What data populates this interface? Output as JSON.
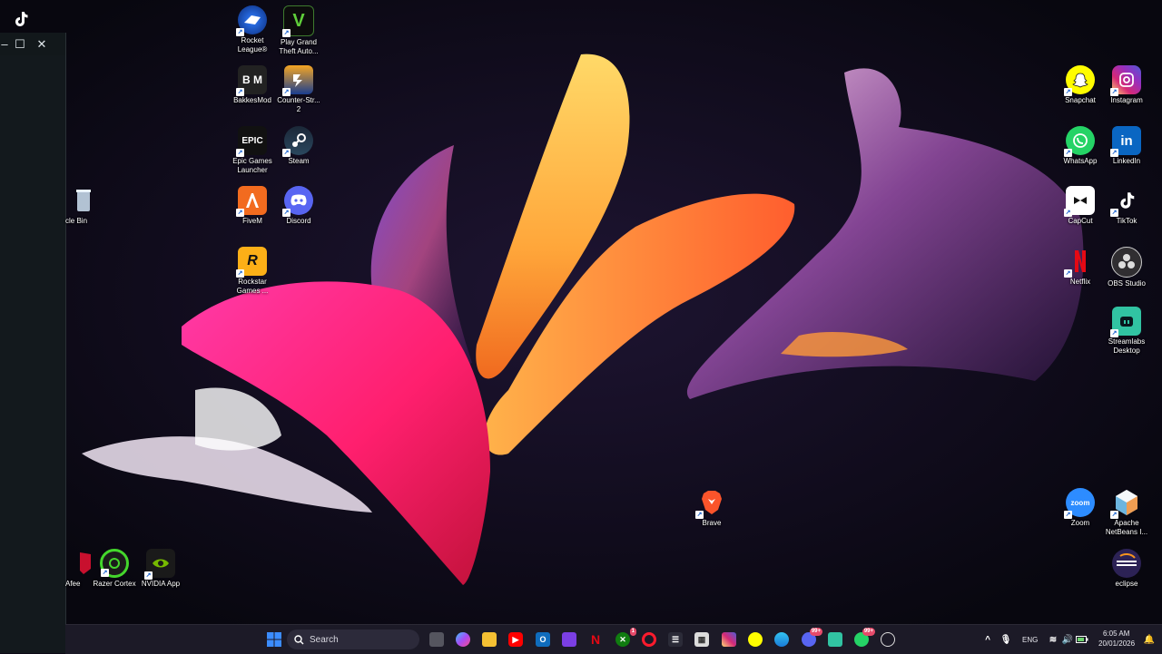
{
  "window": {
    "minimize_label": "–",
    "maximize_label": "☐",
    "close_label": "✕"
  },
  "desktop_icons": {
    "rocket_league": "Rocket League®",
    "gta": "Play Grand Theft Auto...",
    "bakkesmod": "BakkesMod",
    "counter_strike": "Counter-Str... 2",
    "epic_games": "Epic Games Launcher",
    "steam": "Steam",
    "recycle_bin": "cle Bin",
    "fivem": "FiveM",
    "discord": "Discord",
    "rockstar": "Rockstar Games ...",
    "mcafee": "Afee",
    "razer_cortex": "Razer Cortex",
    "nvidia_app": "NVIDIA App",
    "brave": "Brave",
    "snapchat": "Snapchat",
    "instagram": "Instagram",
    "whatsapp": "WhatsApp",
    "linkedin": "LinkedIn",
    "capcut": "CapCut",
    "tiktok": "TikTok",
    "netflix": "Netflix",
    "obs_studio": "OBS Studio",
    "streamlabs": "Streamlabs Desktop",
    "zoom": "Zoom",
    "netbeans": "Apache NetBeans I...",
    "eclipse": "eclipse"
  },
  "icon_glyphs": {
    "bakkesmod": "B M",
    "epic": "EPIC",
    "rockstar": "R",
    "zoom": "zoom",
    "linkedin": "in",
    "gta": "V"
  },
  "taskbar": {
    "search_placeholder": "Search",
    "language": "ENG",
    "time": "6:05 AM",
    "date": "20/01/2026",
    "xbox_badge": "1",
    "messenger_badge": "99+",
    "whatsapp_badge": "99+"
  },
  "colors": {
    "accent": "#3b8cff",
    "taskbar_bg": "#1c1a27",
    "wallpaper_bg": "#0c0a16"
  }
}
